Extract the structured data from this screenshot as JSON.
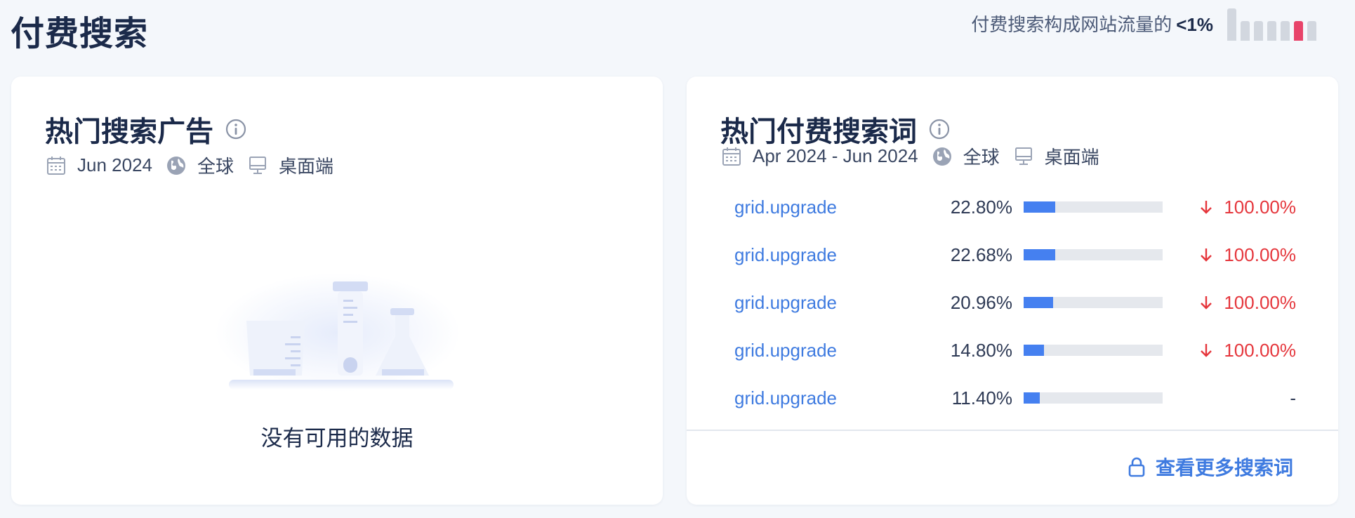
{
  "page": {
    "title": "付费搜索",
    "share_label": "付费搜索构成网站流量的",
    "share_value": "<1%",
    "share_bars_active_index": 5,
    "colors": {
      "active_bar": "#e8446a",
      "inactive_bar": "#d2d7df"
    }
  },
  "ads_card": {
    "title": "热门搜索广告",
    "info_icon": "info-icon",
    "date": "Jun 2024",
    "region": "全球",
    "device": "桌面端",
    "empty_text": "没有可用的数据"
  },
  "keywords_card": {
    "title": "热门付费搜索词",
    "info_icon": "info-icon",
    "date": "Apr 2024 - Jun 2024",
    "region": "全球",
    "device": "桌面端",
    "rows": [
      {
        "keyword": "grid.upgrade",
        "share": "22.80%",
        "share_value": 22.8,
        "change": "100.00%",
        "direction": "down"
      },
      {
        "keyword": "grid.upgrade",
        "share": "22.68%",
        "share_value": 22.68,
        "change": "100.00%",
        "direction": "down"
      },
      {
        "keyword": "grid.upgrade",
        "share": "20.96%",
        "share_value": 20.96,
        "change": "100.00%",
        "direction": "down"
      },
      {
        "keyword": "grid.upgrade",
        "share": "14.80%",
        "share_value": 14.8,
        "change": "100.00%",
        "direction": "down"
      },
      {
        "keyword": "grid.upgrade",
        "share": "11.40%",
        "share_value": 11.4,
        "change": "-",
        "direction": "none"
      }
    ],
    "more_label": "查看更多搜索词",
    "colors": {
      "keyword": "#3f7be0",
      "bar_fill": "#4580f0",
      "negative": "#e5363c"
    }
  }
}
